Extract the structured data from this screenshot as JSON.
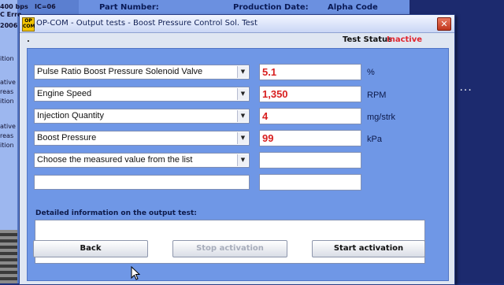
{
  "background": {
    "left_text": [
      "400 bps",
      "IC=06",
      "C Erro",
      "2006"
    ],
    "side_fragments": [
      "ition",
      "ative",
      "reas",
      "ition",
      "ative",
      "reas",
      "ition"
    ],
    "headers": {
      "part_number": "Part Number:",
      "production_date": "Production Date:",
      "alpha_code": "Alpha Code"
    },
    "right_dots": "..."
  },
  "dialog": {
    "app_logo": "OP COM",
    "title": "OP-COM - Output tests - Boost Pressure Control Sol. Test",
    "close_glyph": "✕",
    "dot": ".",
    "test_status_label": "Test Status",
    "test_status_value": "Inactive",
    "rows": [
      {
        "select": "Pulse Ratio Boost Pressure Solenoid Valve",
        "value": "5.1",
        "unit": "%"
      },
      {
        "select": "Engine Speed",
        "value": "1,350",
        "unit": "RPM"
      },
      {
        "select": "Injection Quantity",
        "value": "4",
        "unit": "mg/strk"
      },
      {
        "select": "Boost Pressure",
        "value": "99",
        "unit": "kPa"
      },
      {
        "select": "Choose the measured value from the list",
        "value": "",
        "unit": ""
      },
      {
        "select": "",
        "value": "",
        "unit": ""
      }
    ],
    "detail_label": "Detailed information on the output test:",
    "detail_text": "",
    "buttons": {
      "back": "Back",
      "stop": "Stop activation",
      "start": "Start activation"
    },
    "colors": {
      "status_inactive": "#e0252e",
      "value_text": "#d82020",
      "panel": "#6f97e6"
    }
  }
}
